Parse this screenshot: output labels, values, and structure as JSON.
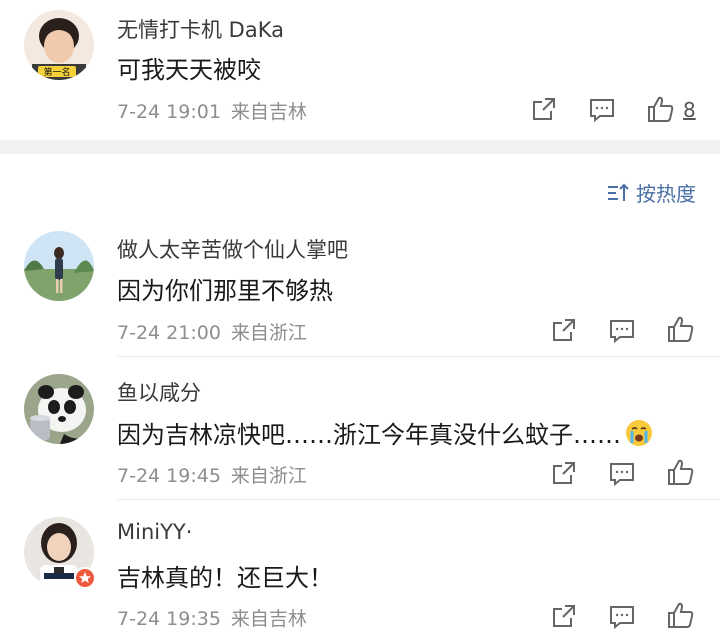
{
  "comments_top": [
    {
      "username": "无情打卡机 DaKa",
      "text": "可我天天被咬",
      "date": "7-24 19:01",
      "location": "来自吉林",
      "like_count": "8",
      "avatar_badge": "第一名"
    }
  ],
  "sort": {
    "label": "按热度"
  },
  "comments": [
    {
      "username": "做人太辛苦做个仙人掌吧",
      "text": "因为你们那里不够热",
      "date": "7-24 21:00",
      "location": "来自浙江"
    },
    {
      "username": "鱼以咸分",
      "text": "因为吉林凉快吧……浙江今年真没什么蚊子……",
      "date": "7-24 19:45",
      "location": "来自浙江",
      "emoji": "crying-face-icon"
    },
    {
      "username": "MiniYY·",
      "text": "吉林真的！还巨大！",
      "date": "7-24 19:35",
      "location": "来自吉林"
    }
  ],
  "colors": {
    "link_blue": "#4a6fa5",
    "meta_gray": "#8e8e8e",
    "section_gap": "#f2f2f2"
  }
}
